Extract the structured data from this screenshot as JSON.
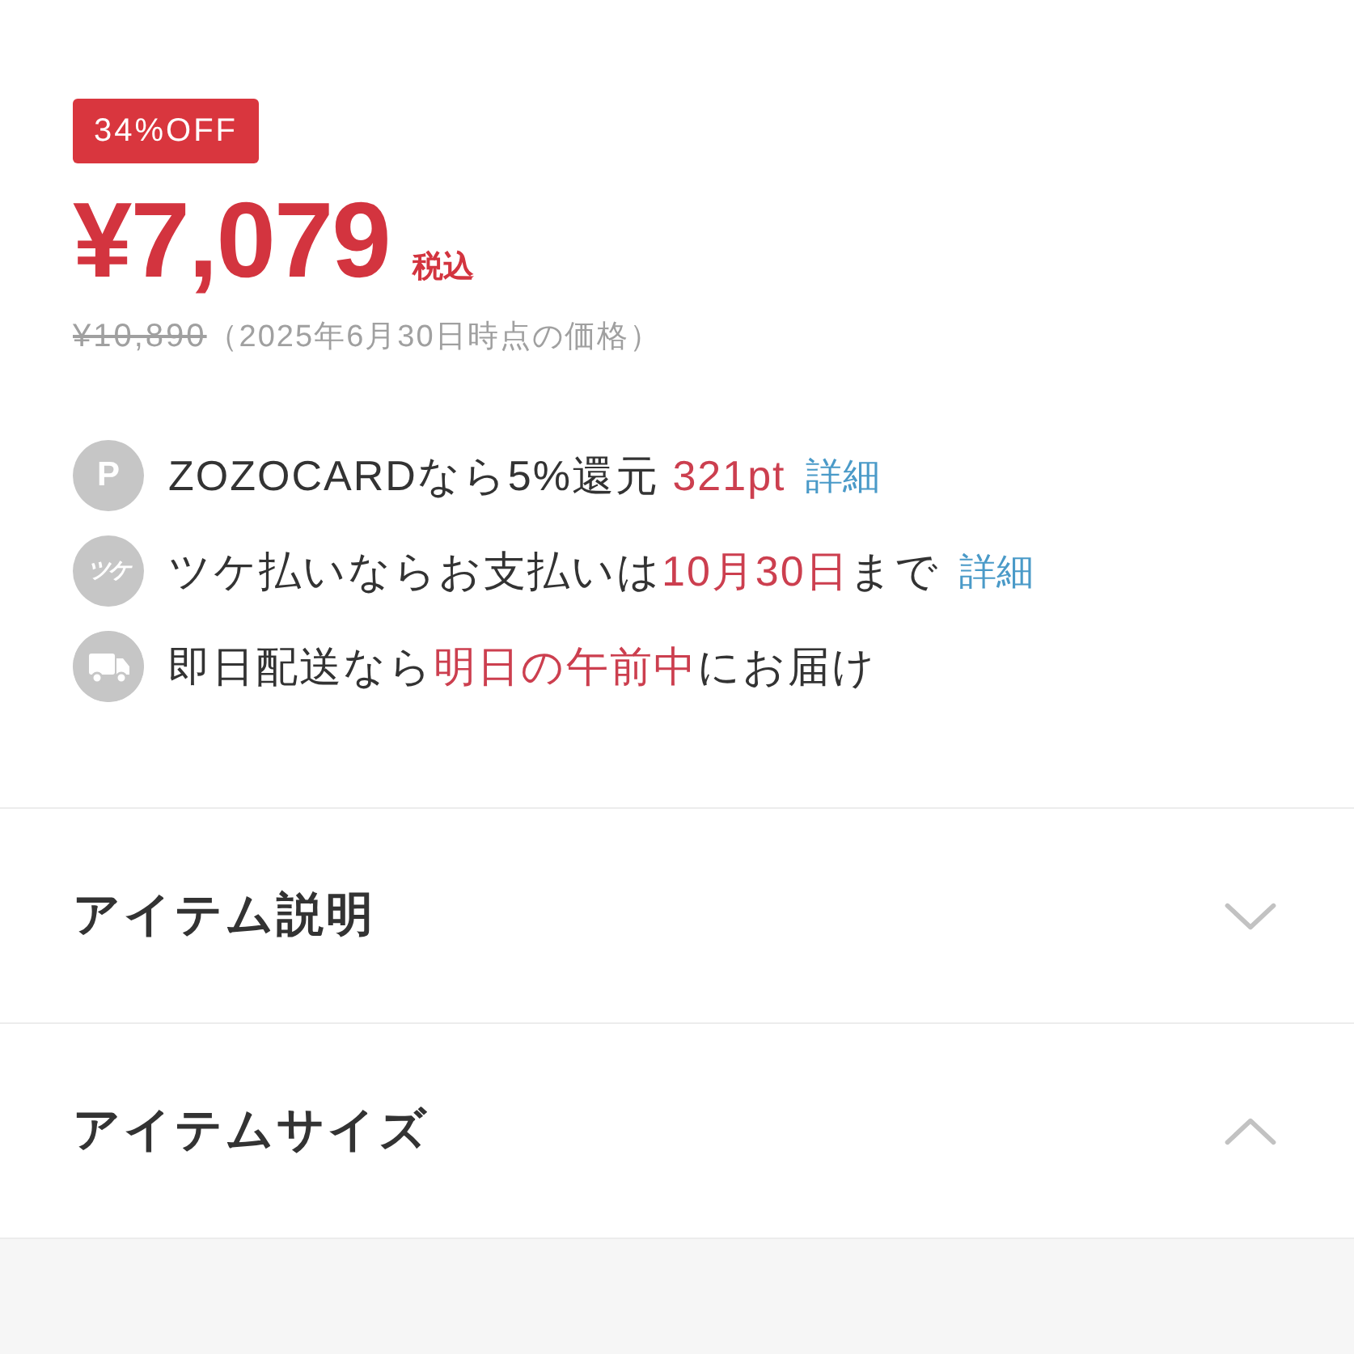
{
  "discount_badge": "34%OFF",
  "price": {
    "amount": "¥7,079",
    "tax_note": "税込",
    "original": "¥10,890",
    "original_note": "（2025年6月30日時点の価格）"
  },
  "benefits": [
    {
      "icon": {
        "kind": "glyph",
        "text": "P"
      },
      "segments": [
        {
          "text": "ZOZOCARDなら5%還元 ",
          "highlight": false
        },
        {
          "text": "321pt",
          "highlight": true
        }
      ],
      "link": "詳細"
    },
    {
      "icon": {
        "kind": "glyph",
        "text": "ツケ"
      },
      "segments": [
        {
          "text": "ツケ払いならお支払いは",
          "highlight": false
        },
        {
          "text": "10月30日",
          "highlight": true
        },
        {
          "text": "まで",
          "highlight": false
        }
      ],
      "link": "詳細"
    },
    {
      "icon": {
        "kind": "truck"
      },
      "segments": [
        {
          "text": "即日配送なら",
          "highlight": false
        },
        {
          "text": "明日の午前中",
          "highlight": true
        },
        {
          "text": "にお届け",
          "highlight": false
        }
      ]
    }
  ],
  "accordions": [
    {
      "title": "アイテム説明",
      "expanded": false
    },
    {
      "title": "アイテムサイズ",
      "expanded": true
    }
  ]
}
